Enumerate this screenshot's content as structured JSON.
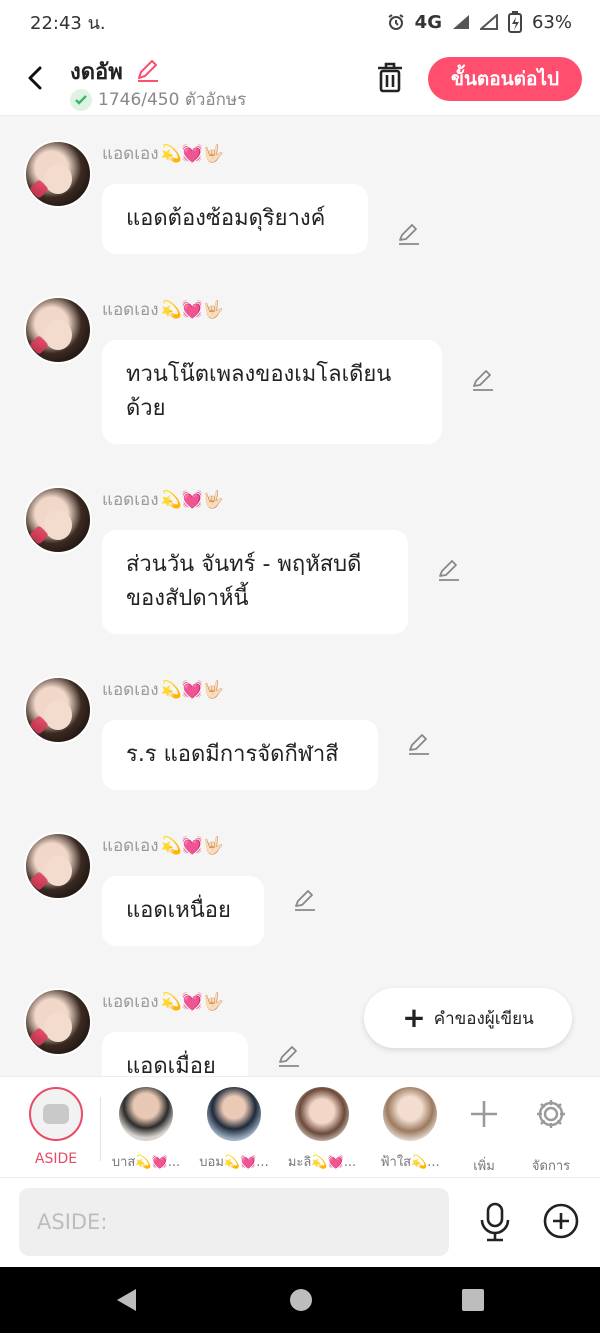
{
  "status": {
    "time": "22:43 น.",
    "network": "4G",
    "battery": "63%"
  },
  "header": {
    "title": "งดอัพ",
    "counter": "1746/450 ตัวอักษร",
    "next_label": "ขั้นตอนต่อไป"
  },
  "messages": [
    {
      "sender": "แอดเอง",
      "emoji": "💫💓🤟🏻",
      "text": "แอดต้องซ้อมดุริยางค์"
    },
    {
      "sender": "แอดเอง",
      "emoji": "💫💓🤟🏻",
      "text": "ทวนโน๊ตเพลงของเมโลเดียนด้วย"
    },
    {
      "sender": "แอดเอง",
      "emoji": "💫💓🤟🏻",
      "text": "ส่วนวัน จันทร์ - พฤหัสบดีของสัปดาห์นี้"
    },
    {
      "sender": "แอดเอง",
      "emoji": "💫💓🤟🏻",
      "text": "ร.ร แอดมีการจัดกีฬาสี"
    },
    {
      "sender": "แอดเอง",
      "emoji": "💫💓🤟🏻",
      "text": "แอดเหนื่อย"
    },
    {
      "sender": "แอดเอง",
      "emoji": "💫💓🤟🏻",
      "text": "แอดเมื่อย"
    }
  ],
  "fab": {
    "label": "คำของผู้เขียน"
  },
  "characters": {
    "aside": "ASIDE",
    "items": [
      "บาส💫💓...",
      "บอม💫💓...",
      "มะลิ💫💓...",
      "ฟ้าใส💫..."
    ],
    "add": "เพิ่ม",
    "manage": "จัดการ"
  },
  "input": {
    "placeholder": "ASIDE:"
  }
}
